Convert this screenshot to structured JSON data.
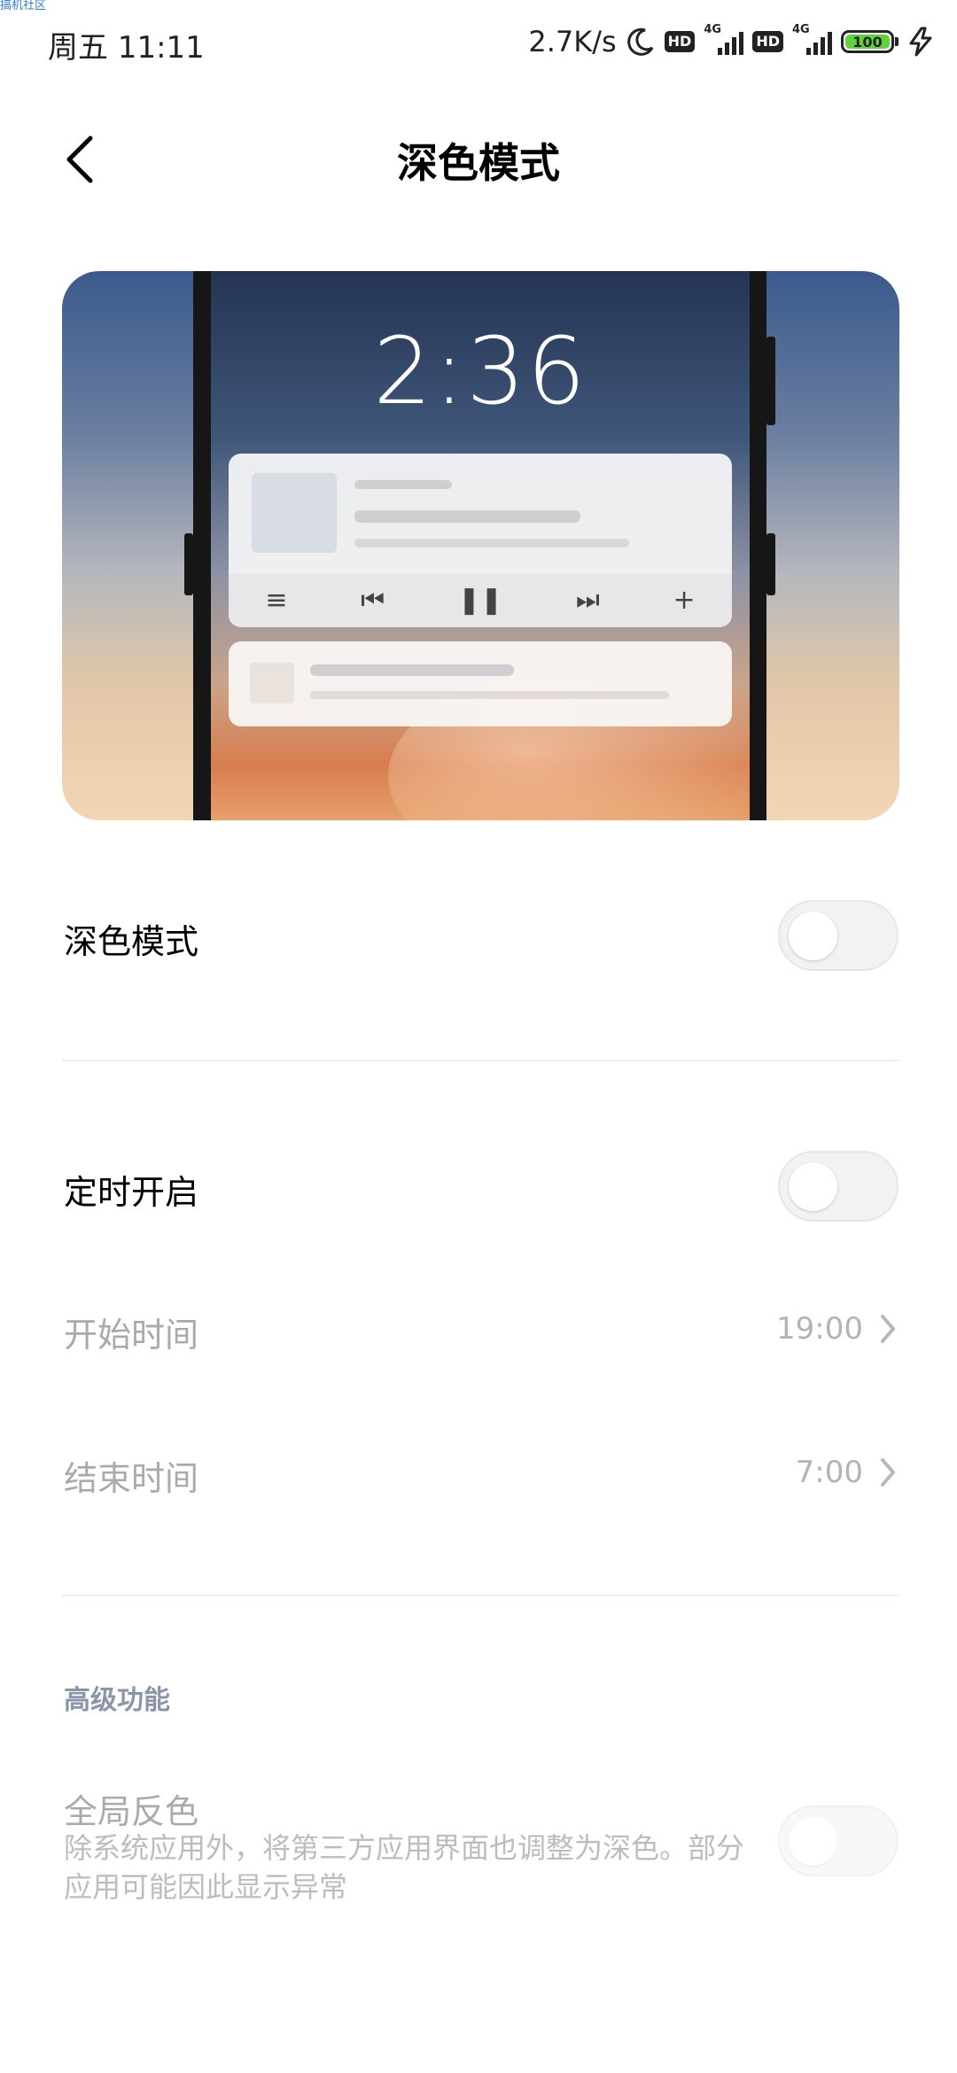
{
  "watermark": "搞机社区",
  "status_bar": {
    "time": "周五 11:11",
    "net_speed": "2.7K/s",
    "hd_label": "HD",
    "network_type": "4G",
    "battery": "100"
  },
  "header": {
    "title": "深色模式"
  },
  "preview": {
    "lock_time": "2:36"
  },
  "settings": {
    "dark_mode": {
      "label": "深色模式",
      "enabled": false
    },
    "schedule": {
      "label": "定时开启",
      "enabled": false
    },
    "start_time": {
      "label": "开始时间",
      "value": "19:00"
    },
    "end_time": {
      "label": "结束时间",
      "value": "7:00"
    },
    "advanced_section": "高级功能",
    "global_invert": {
      "label": "全局反色",
      "description": "除系统应用外，将第三方应用界面也调整为深色。部分应用可能因此显示异常",
      "enabled": false
    }
  }
}
